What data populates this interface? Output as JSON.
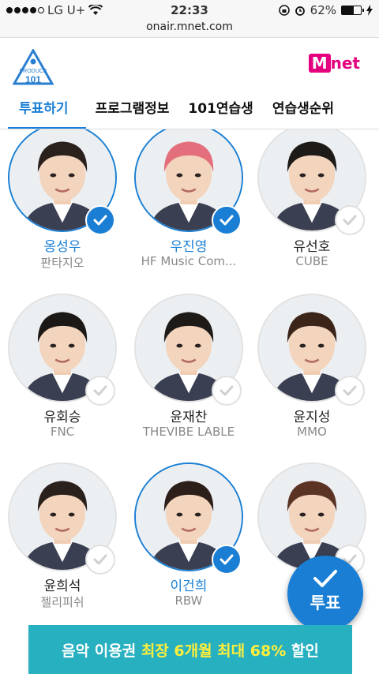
{
  "status_bar": {
    "carrier": "LG U+",
    "time": "22:33",
    "battery": "62%",
    "battery_level": 0.62
  },
  "browser": {
    "url": "onair.mnet.com"
  },
  "header": {
    "mnet_m": "M",
    "mnet_net": "net",
    "produce_text": "PRODUCE",
    "produce_number": "101"
  },
  "tabs": [
    "투표하기",
    "프로그램정보",
    "101연습생",
    "연습생순위"
  ],
  "trainees": [
    {
      "name": "옹성우",
      "agency": "판타지오",
      "selected": true,
      "hair": "#2a201c"
    },
    {
      "name": "우진영",
      "agency": "HF Music Com...",
      "selected": true,
      "hair": "#e36f7c"
    },
    {
      "name": "유선호",
      "agency": "CUBE",
      "selected": false,
      "hair": "#1e1a18"
    },
    {
      "name": "유회승",
      "agency": "FNC",
      "selected": false,
      "hair": "#1c1816"
    },
    {
      "name": "윤재찬",
      "agency": "THEVIBE LABLE",
      "selected": false,
      "hair": "#1e1a18"
    },
    {
      "name": "윤지성",
      "agency": "MMO",
      "selected": false,
      "hair": "#3b2418"
    },
    {
      "name": "윤희석",
      "agency": "젤리피쉬",
      "selected": false,
      "hair": "#2a201c"
    },
    {
      "name": "이건희",
      "agency": "RBW",
      "selected": true,
      "hair": "#2c1f1a"
    },
    {
      "name": "",
      "agency": "",
      "selected": false,
      "hair": "#5a3324"
    }
  ],
  "vote_button": {
    "label": "투표"
  },
  "banner": {
    "part1": "음악 이용권 ",
    "highlight": "최장 6개월 최대 68%",
    "part2": " 할인"
  }
}
